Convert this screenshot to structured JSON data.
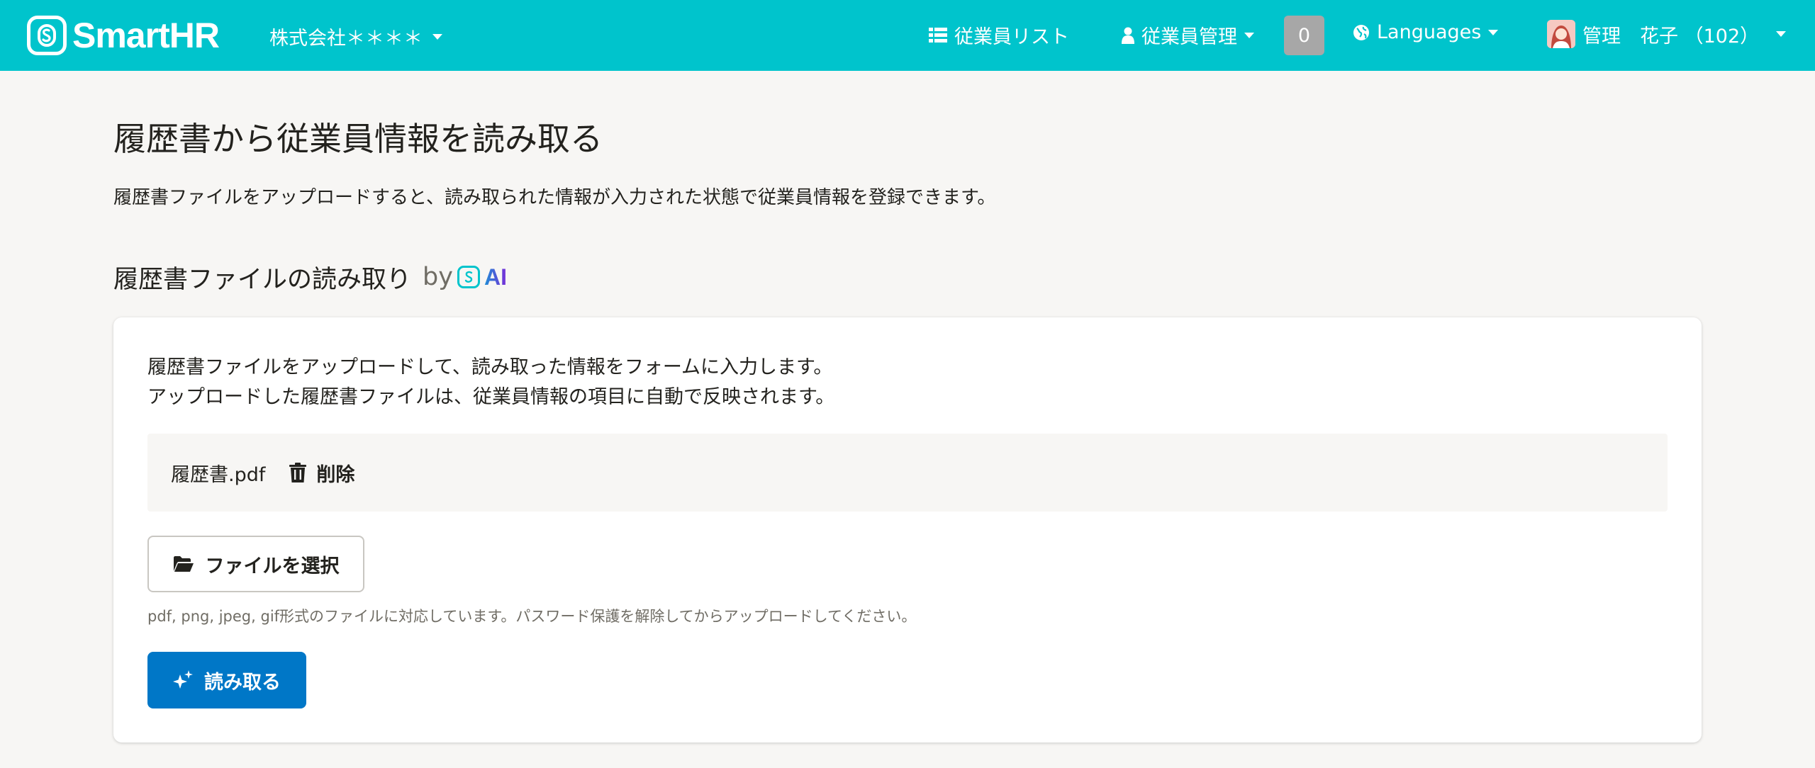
{
  "header": {
    "logo_text": "SmartHR",
    "company_name": "株式会社＊＊＊＊",
    "nav_employee_list": "従業員リスト",
    "nav_employee_management": "従業員管理",
    "notification_count": "0",
    "nav_languages": "Languages",
    "user_name": "管理　花子 （102）",
    "brand_color": "#00c4cc"
  },
  "page": {
    "title": "履歴書から従業員情報を読み取る",
    "description": "履歴書ファイルをアップロードすると、読み取られた情報が入力された状態で従業員情報を登録できます。"
  },
  "section": {
    "title": "履歴書ファイルの読み取り",
    "by_label": "by",
    "ai_label": "AI"
  },
  "card": {
    "desc_line1": "履歴書ファイルをアップロードして、読み取った情報をフォームに入力します。",
    "desc_line2": "アップロードした履歴書ファイルは、従業員情報の項目に自動で反映されます。",
    "file_name": "履歴書.pdf",
    "delete_label": "削除",
    "select_file_label": "ファイルを選択",
    "help_text": "pdf, png, jpeg, gif形式のファイルに対応しています。パスワード保護を解除してからアップロードしてください。",
    "read_button_label": "読み取る",
    "primary_color": "#0077c7"
  },
  "icons": [
    "smarthr-logo-icon",
    "chevron-down-icon",
    "list-icon",
    "user-icon",
    "globe-icon",
    "avatar",
    "trash-icon",
    "folder-open-icon",
    "sparkle-icon"
  ]
}
